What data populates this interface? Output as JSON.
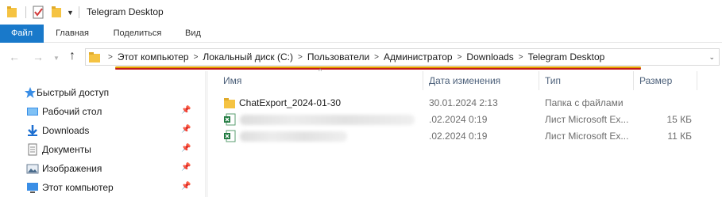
{
  "window": {
    "title": "Telegram Desktop"
  },
  "ribbon": {
    "tabs": [
      "Файл",
      "Главная",
      "Поделиться",
      "Вид"
    ]
  },
  "address": {
    "crumbs": [
      "Этот компьютер",
      "Локальный диск (C:)",
      "Пользователи",
      "Администратор",
      "Downloads",
      "Telegram Desktop"
    ]
  },
  "sidebar": {
    "quick_access": "Быстрый доступ",
    "items": [
      {
        "label": "Рабочий стол",
        "icon": "desktop-icon"
      },
      {
        "label": "Downloads",
        "icon": "download-arrow-icon"
      },
      {
        "label": "Документы",
        "icon": "documents-icon"
      },
      {
        "label": "Изображения",
        "icon": "pictures-icon"
      },
      {
        "label": "Этот компьютер",
        "icon": "computer-icon"
      }
    ]
  },
  "columns": {
    "name": "Имя",
    "date": "Дата изменения",
    "type": "Тип",
    "size": "Размер"
  },
  "files": [
    {
      "name": "ChatExport_2024-01-30",
      "date": "30.01.2024 2:13",
      "type": "Папка с файлами",
      "size": "",
      "icon": "folder-icon"
    },
    {
      "name": "",
      "date": ".02.2024 0:19",
      "type": "Лист Microsoft Ex...",
      "size": "15 КБ",
      "icon": "excel-icon"
    },
    {
      "name": "",
      "date": ".02.2024 0:19",
      "type": "Лист Microsoft Ex...",
      "size": "11 КБ",
      "icon": "excel-icon"
    }
  ],
  "colors": {
    "file_tab": "#1979ca",
    "folder": "#f5c342",
    "excel": "#1f7a3f",
    "highlight_orange": "#e0a000",
    "highlight_red": "#c41a1a"
  }
}
